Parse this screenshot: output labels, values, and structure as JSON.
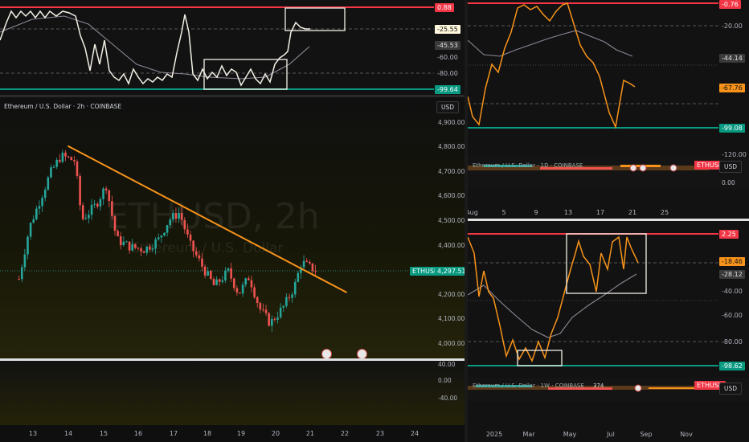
{
  "top_left_osc": {
    "levels": [
      {
        "text": "0.88",
        "bg": "#f23645",
        "fg": "#ffffff"
      },
      {
        "text": "-25.55",
        "bg": "#fff8dc",
        "fg": "#111111"
      },
      {
        "text": "-45.53",
        "bg": "#3a3a3a",
        "fg": "#e0e0e0"
      },
      {
        "text": "-60.00",
        "bg": "transparent",
        "fg": "#b2b5be"
      },
      {
        "text": "-80.00",
        "bg": "transparent",
        "fg": "#b2b5be"
      },
      {
        "text": "-99.64",
        "bg": "#089981",
        "fg": "#ffffff"
      }
    ]
  },
  "main_chart": {
    "header": "Ethereum / U.S. Dollar · 2h · COINBASE",
    "currency": "USD",
    "watermark_symbol": "ETHUSD, 2h",
    "watermark_name": "Ethereum / U.S. Dollar",
    "price_ticks": [
      "4,900.00",
      "4,800.00",
      "4,700.00",
      "4,600.00",
      "4,500.00",
      "4,400.00",
      "4,200.00",
      "4,100.00",
      "4,000.00"
    ],
    "symbol_tag": "ETHUSD",
    "last_price": "4,297.51",
    "x_ticks": [
      "13",
      "14",
      "15",
      "16",
      "17",
      "18",
      "19",
      "20",
      "21",
      "22",
      "23",
      "24"
    ],
    "colors": {
      "up": "#26a69a",
      "down": "#ef5350",
      "trendline": "#f7931a"
    },
    "chart_data": {
      "type": "candlestick",
      "title": "Ethereum / U.S. Dollar · 2h · COINBASE",
      "x_range": [
        13,
        24
      ],
      "y_range": [
        3950,
        4950
      ],
      "trendline": [
        {
          "x": 14.0,
          "y": 4800
        },
        {
          "x": 22.0,
          "y": 4205
        }
      ],
      "close_path": [
        {
          "x": 12.6,
          "y": 4260
        },
        {
          "x": 12.9,
          "y": 4470
        },
        {
          "x": 13.2,
          "y": 4580
        },
        {
          "x": 13.5,
          "y": 4690
        },
        {
          "x": 13.8,
          "y": 4760
        },
        {
          "x": 14.2,
          "y": 4740
        },
        {
          "x": 14.4,
          "y": 4500
        },
        {
          "x": 14.8,
          "y": 4560
        },
        {
          "x": 15.1,
          "y": 4640
        },
        {
          "x": 15.4,
          "y": 4420
        },
        {
          "x": 15.8,
          "y": 4390
        },
        {
          "x": 16.2,
          "y": 4380
        },
        {
          "x": 16.6,
          "y": 4420
        },
        {
          "x": 16.9,
          "y": 4500
        },
        {
          "x": 17.2,
          "y": 4530
        },
        {
          "x": 17.5,
          "y": 4400
        },
        {
          "x": 17.9,
          "y": 4300
        },
        {
          "x": 18.2,
          "y": 4230
        },
        {
          "x": 18.6,
          "y": 4290
        },
        {
          "x": 18.9,
          "y": 4200
        },
        {
          "x": 19.2,
          "y": 4270
        },
        {
          "x": 19.5,
          "y": 4140
        },
        {
          "x": 19.8,
          "y": 4080
        },
        {
          "x": 20.2,
          "y": 4150
        },
        {
          "x": 20.5,
          "y": 4230
        },
        {
          "x": 20.7,
          "y": 4330
        },
        {
          "x": 20.9,
          "y": 4310
        },
        {
          "x": 21.1,
          "y": 4297
        }
      ]
    }
  },
  "bottom_left_osc": {
    "ticks": [
      "40.00",
      "0.00",
      "-40.00"
    ]
  },
  "top_right_chart": {
    "levels": [
      {
        "text": "-0.76",
        "bg": "#f23645",
        "fg": "#ffffff"
      },
      {
        "text": "-20.00",
        "bg": "transparent",
        "fg": "#b2b5be"
      },
      {
        "text": "-44.14",
        "bg": "#3a3a3a",
        "fg": "#e0e0e0"
      },
      {
        "text": "-67.76",
        "bg": "#f7931a",
        "fg": "#111111"
      },
      {
        "text": "-99.08",
        "bg": "#089981",
        "fg": "#ffffff"
      },
      {
        "text": "-120.00",
        "bg": "transparent",
        "fg": "#b2b5be"
      }
    ],
    "currency": "USD",
    "symbol_tag": "ETHUSD",
    "lower_tick": "0.00",
    "x_ticks": [
      "Aug",
      "5",
      "9",
      "13",
      "17",
      "21",
      "25"
    ],
    "strip_text": "Ethereum / U.S. Dollar · 1D · COINBASE"
  },
  "bottom_right_chart": {
    "levels": [
      {
        "text": "2.25",
        "bg": "#f23645",
        "fg": "#ffffff"
      },
      {
        "text": "-18.46",
        "bg": "#f7931a",
        "fg": "#111111"
      },
      {
        "text": "-28.12",
        "bg": "#3a3a3a",
        "fg": "#e0e0e0"
      },
      {
        "text": "-40.00",
        "bg": "transparent",
        "fg": "#b2b5be"
      },
      {
        "text": "-60.00",
        "bg": "transparent",
        "fg": "#b2b5be"
      },
      {
        "text": "-80.00",
        "bg": "transparent",
        "fg": "#b2b5be"
      },
      {
        "text": "-98.62",
        "bg": "#089981",
        "fg": "#ffffff"
      }
    ],
    "currency": "USD",
    "symbol_tag": "ETHUSD",
    "mini_value": "374",
    "x_ticks": [
      "2025",
      "Mar",
      "May",
      "Jul",
      "Sep",
      "Nov"
    ],
    "strip_text": "Ethereum / U.S. Dollar · 1W · COINBASE"
  }
}
